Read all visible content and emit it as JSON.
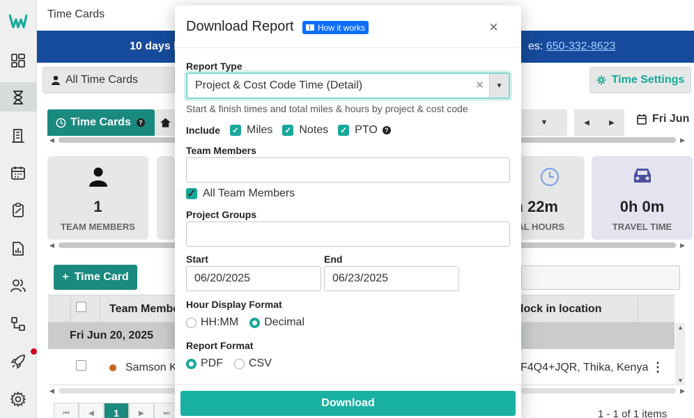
{
  "app": {
    "page_title": "Time Cards",
    "brand_color": "#18a89a"
  },
  "rail": {
    "icons": [
      "dashboard-icon",
      "hourglass-icon",
      "building-icon",
      "calendar-icon",
      "clipboard-icon",
      "report-icon",
      "people-icon",
      "workflow-icon",
      "rocket-icon",
      "gear-icon"
    ]
  },
  "banner": {
    "left_text": "10 days l",
    "right_label": "es: ",
    "phone": "650-332-8623"
  },
  "filter": {
    "label": "All Time Cards"
  },
  "settings": {
    "label": "Time Settings"
  },
  "tabs": {
    "time_cards": "Time Cards"
  },
  "date_header": "Fri Jun",
  "stats": [
    {
      "num": "1",
      "label": "TEAM MEMBERS"
    },
    {
      "num": "n 22m",
      "label": "AL HOURS"
    },
    {
      "num": "0h 0m",
      "label": "TRAVEL TIME"
    }
  ],
  "add_button": "Time Card",
  "grid": {
    "col_member": "Team Membe",
    "col_location": "lock in location",
    "group": "Fri Jun 20, 2025",
    "row": {
      "name": "Samson K",
      "location": "F4Q4+JQR, Thika, Kenya"
    }
  },
  "pager": {
    "current": "1",
    "info": "1 - 1 of 1 items"
  },
  "modal": {
    "title": "Download Report",
    "how_it_works": "How it works",
    "report_type_label": "Report Type",
    "report_type_value": "Project & Cost Code Time (Detail)",
    "report_type_hint": "Start & finish times and total miles & hours by project & cost code",
    "include_label": "Include",
    "include_options": [
      "Miles",
      "Notes",
      "PTO"
    ],
    "team_members_label": "Team Members",
    "all_team_members": "All Team Members",
    "project_groups_label": "Project Groups",
    "start_label": "Start",
    "start_value": "06/20/2025",
    "end_label": "End",
    "end_value": "06/23/2025",
    "hour_format_label": "Hour Display Format",
    "hour_format_options": [
      "HH:MM",
      "Decimal"
    ],
    "hour_format_selected": "Decimal",
    "report_format_label": "Report Format",
    "report_format_options": [
      "PDF",
      "CSV"
    ],
    "report_format_selected": "PDF",
    "download": "Download"
  }
}
